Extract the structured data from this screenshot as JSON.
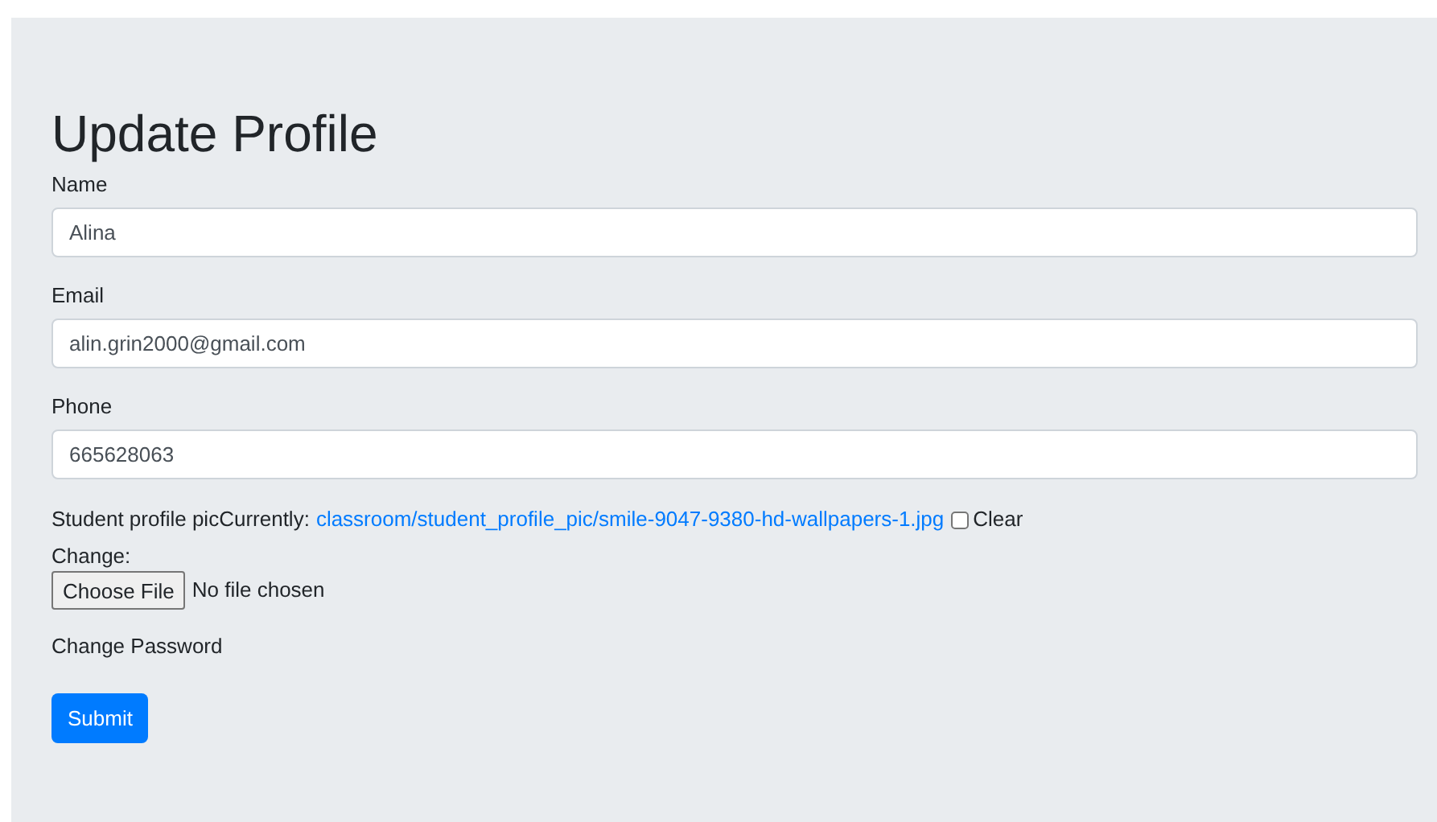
{
  "title": "Update Profile",
  "fields": [
    {
      "label": "Name",
      "value": "Alina"
    },
    {
      "label": "Email",
      "value": "alin.grin2000@gmail.com"
    },
    {
      "label": "Phone",
      "value": "665628063"
    }
  ],
  "picture_field": {
    "label": "Student profile pic",
    "currently_label": "Currently:",
    "link": "classroom/student_profile_pic/smile-9047-9380-hd-wallpapers-1.jpg",
    "clear": {
      "label": "Clear",
      "checked": false
    },
    "change_label": "Change:",
    "choose_button": "Choose File",
    "file_status": "No file chosen"
  },
  "change_password": "Change Password",
  "submit": "Submit"
}
